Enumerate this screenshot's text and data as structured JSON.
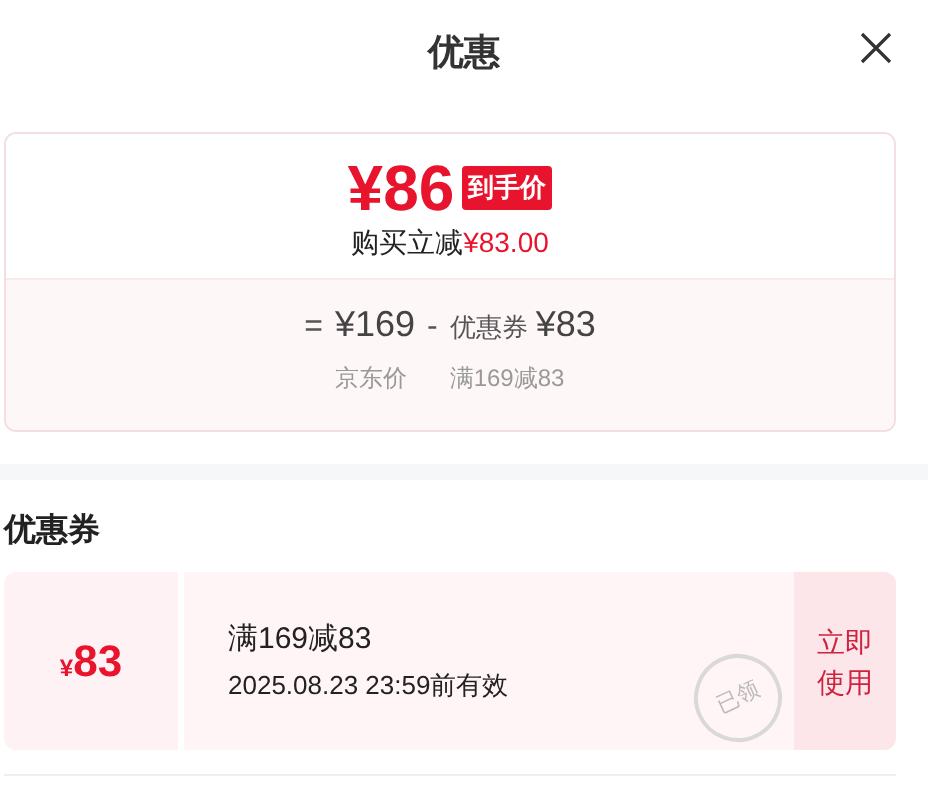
{
  "header": {
    "title": "优惠"
  },
  "price_card": {
    "final_price": "¥86",
    "badge": "到手价",
    "saving_label": "购买立减",
    "saving_amount": "¥83.00",
    "formula": [
      {
        "kind": "operator",
        "text": "="
      },
      {
        "kind": "price",
        "value": "¥169",
        "caption": "京东价"
      },
      {
        "kind": "operator",
        "text": "-"
      },
      {
        "kind": "discount",
        "label": "优惠券",
        "value": "¥83",
        "caption": "满169减83"
      }
    ]
  },
  "coupons_section": {
    "title": "优惠券",
    "coupons": [
      {
        "currency": "¥",
        "amount": "83",
        "rule": "满169减83",
        "validity": "2025.08.23 23:59前有效",
        "stamp": "已领",
        "claimed": true,
        "action": "立即使用"
      }
    ]
  }
}
